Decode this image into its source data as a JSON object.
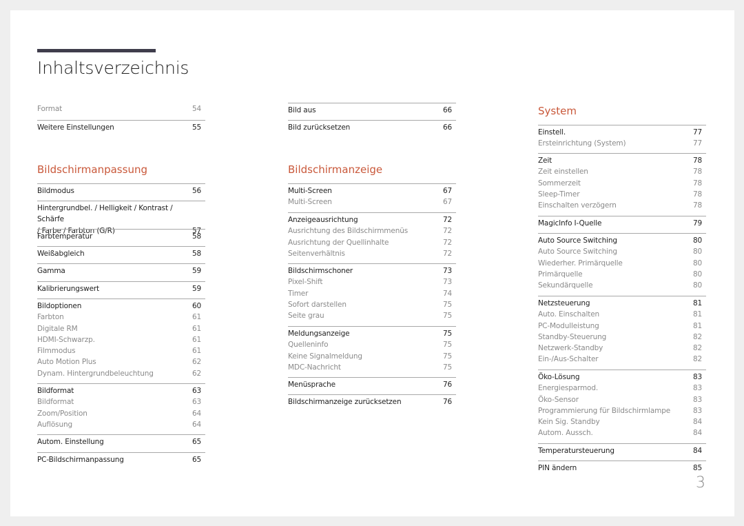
{
  "page": {
    "title": "Inhaltsverzeichnis",
    "page_number": "3",
    "accent_color": "#c9583a",
    "title_bar_color": "#3f3d4c"
  },
  "col1": {
    "top": [
      {
        "label": "Format",
        "page": "54",
        "type": "sub"
      },
      {
        "label": "Weitere Einstellungen",
        "page": "55",
        "type": "main"
      }
    ],
    "section": {
      "heading": "Bildschirmanpassung",
      "groups": [
        [
          {
            "label": "Bildmodus",
            "page": "56",
            "type": "main"
          }
        ],
        [
          {
            "label": "Hintergrundbel. / Helligkeit / Kontrast / Schärfe\n/ Farbe / Farbton (G/R)",
            "page": "57",
            "type": "main"
          }
        ],
        [
          {
            "label": "Farbtemperatur",
            "page": "58",
            "type": "main"
          }
        ],
        [
          {
            "label": "Weißabgleich",
            "page": "58",
            "type": "main"
          }
        ],
        [
          {
            "label": "Gamma",
            "page": "59",
            "type": "main"
          }
        ],
        [
          {
            "label": "Kalibrierungswert",
            "page": "59",
            "type": "main"
          }
        ],
        [
          {
            "label": "Bildoptionen",
            "page": "60",
            "type": "main"
          },
          {
            "label": "Farbton",
            "page": "61",
            "type": "sub"
          },
          {
            "label": "Digitale RM",
            "page": "61",
            "type": "sub"
          },
          {
            "label": "HDMI-Schwarzp.",
            "page": "61",
            "type": "sub"
          },
          {
            "label": "Filmmodus",
            "page": "61",
            "type": "sub"
          },
          {
            "label": "Auto Motion Plus",
            "page": "62",
            "type": "sub"
          },
          {
            "label": "Dynam. Hintergrundbeleuchtung",
            "page": "62",
            "type": "sub"
          }
        ],
        [
          {
            "label": "Bildformat",
            "page": "63",
            "type": "main"
          },
          {
            "label": "Bildformat",
            "page": "63",
            "type": "sub"
          },
          {
            "label": "Zoom/Position",
            "page": "64",
            "type": "sub"
          },
          {
            "label": "Auflösung",
            "page": "64",
            "type": "sub"
          }
        ],
        [
          {
            "label": "Autom. Einstellung",
            "page": "65",
            "type": "main"
          }
        ],
        [
          {
            "label": "PC-Bildschirmanpassung",
            "page": "65",
            "type": "main"
          }
        ]
      ]
    }
  },
  "col2": {
    "top": [
      [
        {
          "label": "Bild aus",
          "page": "66",
          "type": "main"
        }
      ],
      [
        {
          "label": "Bild zurücksetzen",
          "page": "66",
          "type": "main"
        }
      ]
    ],
    "section": {
      "heading": "Bildschirmanzeige",
      "groups": [
        [
          {
            "label": "Multi-Screen",
            "page": "67",
            "type": "main"
          },
          {
            "label": "Multi-Screen",
            "page": "67",
            "type": "sub"
          }
        ],
        [
          {
            "label": "Anzeigeausrichtung",
            "page": "72",
            "type": "main"
          },
          {
            "label": "Ausrichtung des Bildschirmmenüs",
            "page": "72",
            "type": "sub"
          },
          {
            "label": "Ausrichtung der Quellinhalte",
            "page": "72",
            "type": "sub"
          },
          {
            "label": "Seitenverhältnis",
            "page": "72",
            "type": "sub"
          }
        ],
        [
          {
            "label": "Bildschirmschoner",
            "page": "73",
            "type": "main"
          },
          {
            "label": "Pixel-Shift",
            "page": "73",
            "type": "sub"
          },
          {
            "label": "Timer",
            "page": "74",
            "type": "sub"
          },
          {
            "label": "Sofort darstellen",
            "page": "75",
            "type": "sub"
          },
          {
            "label": "Seite grau",
            "page": "75",
            "type": "sub"
          }
        ],
        [
          {
            "label": "Meldungsanzeige",
            "page": "75",
            "type": "main"
          },
          {
            "label": "Quelleninfo",
            "page": "75",
            "type": "sub"
          },
          {
            "label": "Keine Signalmeldung",
            "page": "75",
            "type": "sub"
          },
          {
            "label": "MDC-Nachricht",
            "page": "75",
            "type": "sub"
          }
        ],
        [
          {
            "label": "Menüsprache",
            "page": "76",
            "type": "main"
          }
        ],
        [
          {
            "label": "Bildschirmanzeige zurücksetzen",
            "page": "76",
            "type": "main"
          }
        ]
      ]
    }
  },
  "col3": {
    "section": {
      "heading": "System",
      "groups": [
        [
          {
            "label": "Einstell.",
            "page": "77",
            "type": "main"
          },
          {
            "label": "Ersteinrichtung (System)",
            "page": "77",
            "type": "sub"
          }
        ],
        [
          {
            "label": "Zeit",
            "page": "78",
            "type": "main"
          },
          {
            "label": "Zeit einstellen",
            "page": "78",
            "type": "sub"
          },
          {
            "label": "Sommerzeit",
            "page": "78",
            "type": "sub"
          },
          {
            "label": "Sleep-Timer",
            "page": "78",
            "type": "sub"
          },
          {
            "label": "Einschalten verzögern",
            "page": "78",
            "type": "sub"
          }
        ],
        [
          {
            "label": "MagicInfo I-Quelle",
            "page": "79",
            "type": "main"
          }
        ],
        [
          {
            "label": "Auto Source Switching",
            "page": "80",
            "type": "main"
          },
          {
            "label": "Auto Source Switching",
            "page": "80",
            "type": "sub"
          },
          {
            "label": "Wiederher. Primärquelle",
            "page": "80",
            "type": "sub"
          },
          {
            "label": "Primärquelle",
            "page": "80",
            "type": "sub"
          },
          {
            "label": "Sekundärquelle",
            "page": "80",
            "type": "sub"
          }
        ],
        [
          {
            "label": "Netzsteuerung",
            "page": "81",
            "type": "main"
          },
          {
            "label": "Auto. Einschalten",
            "page": "81",
            "type": "sub"
          },
          {
            "label": "PC-Modulleistung",
            "page": "81",
            "type": "sub"
          },
          {
            "label": "Standby-Steuerung",
            "page": "82",
            "type": "sub"
          },
          {
            "label": "Netzwerk-Standby",
            "page": "82",
            "type": "sub"
          },
          {
            "label": "Ein-/Aus-Schalter",
            "page": "82",
            "type": "sub"
          }
        ],
        [
          {
            "label": "Öko-Lösung",
            "page": "83",
            "type": "main"
          },
          {
            "label": "Energiesparmod.",
            "page": "83",
            "type": "sub"
          },
          {
            "label": "Öko-Sensor",
            "page": "83",
            "type": "sub"
          },
          {
            "label": "Programmierung für Bildschirmlampe",
            "page": "83",
            "type": "sub"
          },
          {
            "label": "Kein Sig. Standby",
            "page": "84",
            "type": "sub"
          },
          {
            "label": "Autom. Aussch.",
            "page": "84",
            "type": "sub"
          }
        ],
        [
          {
            "label": "Temperatursteuerung",
            "page": "84",
            "type": "main"
          }
        ],
        [
          {
            "label": "PIN ändern",
            "page": "85",
            "type": "main"
          }
        ]
      ]
    }
  }
}
